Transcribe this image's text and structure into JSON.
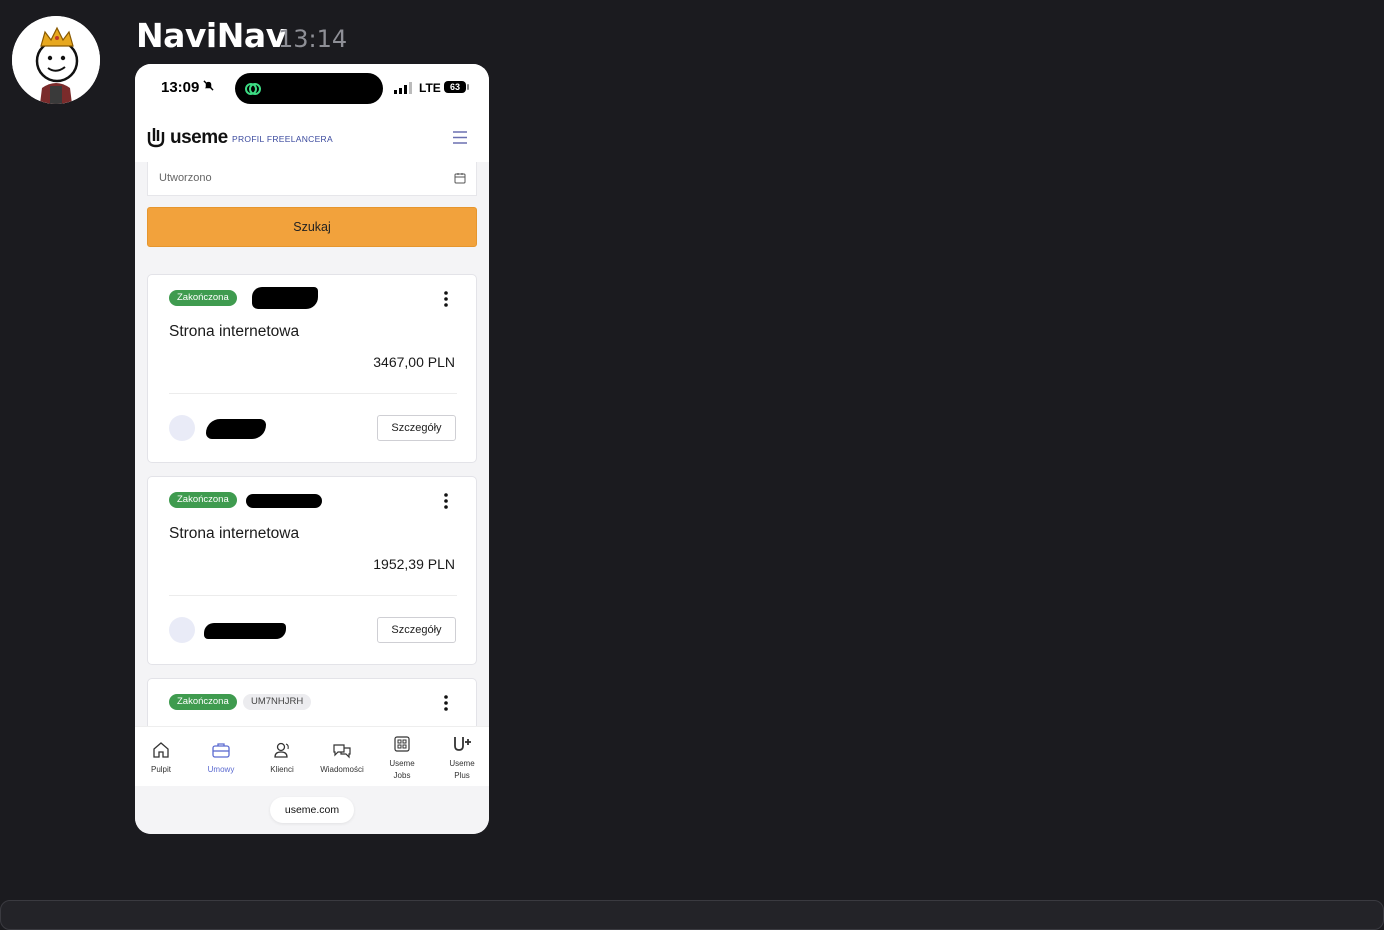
{
  "message": {
    "username": "NaviNav",
    "time": "13:14"
  },
  "phone": {
    "status_time": "13:09",
    "network": "LTE",
    "battery": "63",
    "app": {
      "logo_text": "useme",
      "profile_label": "PROFIL FREELANCERA",
      "date_placeholder": "Utworzono",
      "search_label": "Szukaj",
      "cards": [
        {
          "status": "Zakończona",
          "title": "Strona internetowa",
          "amount": "3467,00 PLN",
          "details": "Szczegóły"
        },
        {
          "status": "Zakończona",
          "title": "Strona internetowa",
          "amount": "1952,39 PLN",
          "details": "Szczegóły"
        },
        {
          "status": "Zakończona",
          "code": "UM7NHJRH"
        }
      ],
      "nav": [
        {
          "label": "Pulpit",
          "icon": "home-icon"
        },
        {
          "label": "Umowy",
          "icon": "briefcase-icon",
          "active": true
        },
        {
          "label": "Klienci",
          "icon": "users-icon"
        },
        {
          "label": "Wiadomości",
          "icon": "chat-icon"
        },
        {
          "label": "Useme Jobs",
          "icon": "grid-icon"
        },
        {
          "label": "Useme Plus",
          "icon": "useme-plus-icon"
        }
      ]
    },
    "url": "useme.com"
  },
  "colors": {
    "background": "#1b1b1f",
    "accent_orange": "#f2a23c",
    "status_green": "#3f9b4f",
    "nav_active": "#5b6ad0"
  }
}
